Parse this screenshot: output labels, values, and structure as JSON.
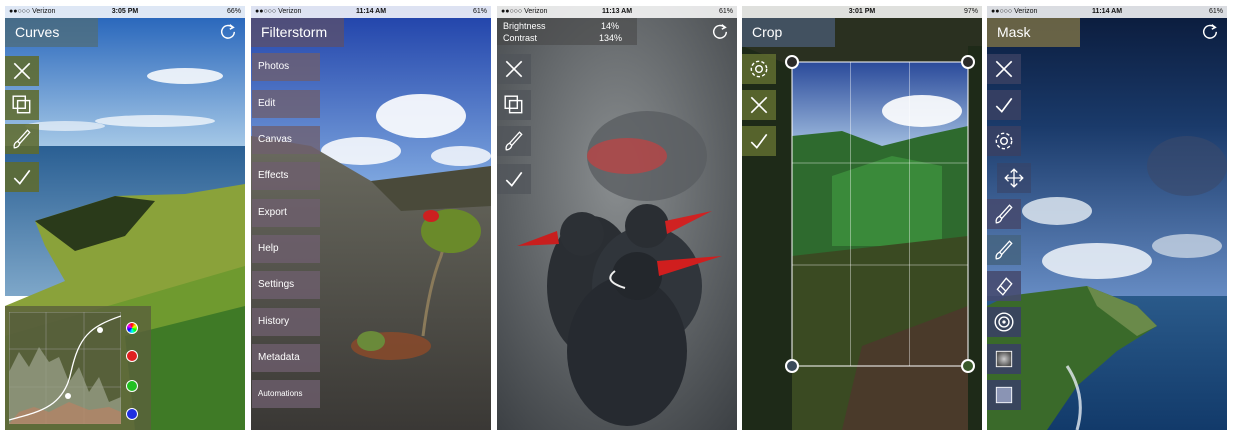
{
  "colors": {
    "olive_tool": "#5f6b2f",
    "olive_title": "#6a7a3a",
    "navy_tool": "#3a4163",
    "purple_menu": "#6e5f6e"
  },
  "panel1": {
    "status": {
      "carrier": "●●○○○ Verizon",
      "time": "3:05 PM",
      "battery": "66%"
    },
    "title": "Curves",
    "tools": [
      "close-icon",
      "layers-icon",
      "brush-icon",
      "check-icon"
    ],
    "curve_swatches": [
      "rgb",
      "red",
      "green",
      "blue"
    ]
  },
  "panel2": {
    "status": {
      "carrier": "●●○○○ Verizon",
      "time": "11:14 AM",
      "battery": "61%"
    },
    "title": "Filterstorm",
    "menu": [
      "Photos",
      "Edit",
      "Canvas",
      "Effects",
      "Export",
      "Help",
      "Settings",
      "History",
      "Metadata",
      "Automations"
    ]
  },
  "panel3": {
    "status": {
      "carrier": "●●○○○ Verizon",
      "time": "11:13 AM",
      "battery": "61%"
    },
    "readout": {
      "brightness_label": "Brightness",
      "brightness_value": "14%",
      "contrast_label": "Contrast",
      "contrast_value": "134%"
    },
    "tools": [
      "close-icon",
      "layers-icon",
      "brush-icon",
      "check-icon"
    ]
  },
  "panel4": {
    "status": {
      "carrier": "",
      "time": "3:01 PM",
      "battery": "97%"
    },
    "title": "Crop",
    "tools": [
      "gear-icon",
      "close-icon",
      "check-icon"
    ]
  },
  "panel5": {
    "status": {
      "carrier": "●●○○○ Verizon",
      "time": "11:14 AM",
      "battery": "61%"
    },
    "title": "Mask",
    "tools": [
      "close-icon",
      "check-icon",
      "gear-icon",
      "move-icon",
      "brush-icon",
      "brush-icon",
      "eraser-icon",
      "target-icon",
      "gradient-icon",
      "rectangle-icon"
    ]
  }
}
